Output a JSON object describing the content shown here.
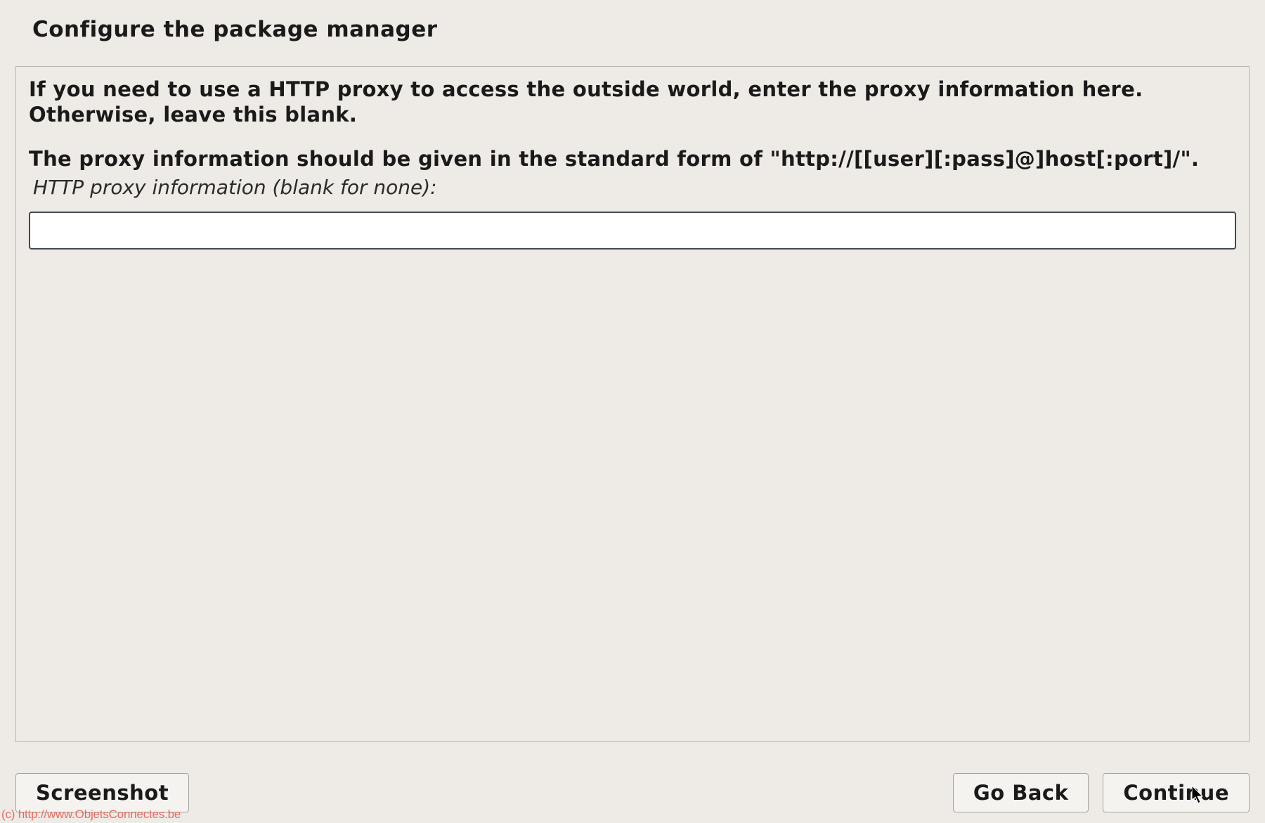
{
  "header": {
    "title": "Configure the package manager"
  },
  "main": {
    "instruction_line1": "If you need to use a HTTP proxy to access the outside world, enter the proxy information here. Otherwise, leave this blank.",
    "instruction_line2": "The proxy information should be given in the standard form of \"http://[[user][:pass]@]host[:port]/\".",
    "field_label": "HTTP proxy information (blank for none):",
    "proxy_value": ""
  },
  "footer": {
    "screenshot_label": "Screenshot",
    "go_back_label": "Go Back",
    "continue_label": "Continue"
  },
  "watermark": "(c) http://www.ObjetsConnectes.be"
}
